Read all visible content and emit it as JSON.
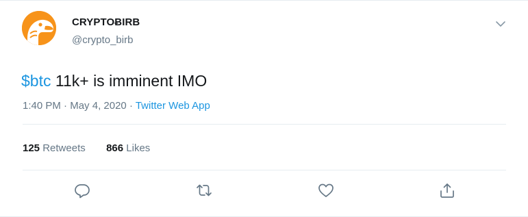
{
  "author": {
    "display_name": "CRYPTOɃIRB",
    "handle": "@crypto_birb"
  },
  "tweet": {
    "cashtag": "$btc",
    "text": " 11k+ is imminent IMO",
    "time": "1:40 PM",
    "separator1": " · ",
    "date": "May 4, 2020",
    "separator2": " · ",
    "source": "Twitter Web App"
  },
  "stats": {
    "retweets_count": "125",
    "retweets_label": "Retweets",
    "likes_count": "866",
    "likes_label": "Likes"
  },
  "icons": {
    "menu": "chevron-down-icon",
    "reply": "reply-icon",
    "retweet": "retweet-icon",
    "like": "heart-icon",
    "share": "share-icon"
  },
  "colors": {
    "link": "#1b95e0",
    "secondary_text": "#657786",
    "primary_text": "#14171a",
    "divider": "#e6ecf0",
    "avatar_bg": "#f7931a"
  }
}
